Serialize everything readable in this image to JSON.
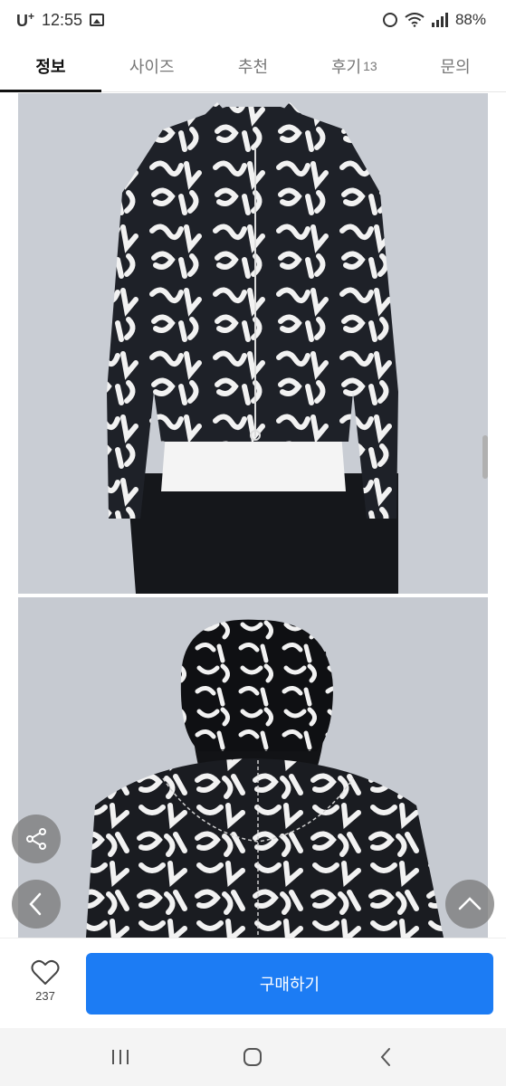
{
  "status_bar": {
    "carrier": "U",
    "carrier_sup": "+",
    "time": "12:55",
    "battery": "88%"
  },
  "tabs": [
    {
      "label": "정보",
      "count": ""
    },
    {
      "label": "사이즈",
      "count": ""
    },
    {
      "label": "추천",
      "count": ""
    },
    {
      "label": "후기",
      "count": "13"
    },
    {
      "label": "문의",
      "count": ""
    }
  ],
  "active_tab": "정보",
  "purchase": {
    "like_count": "237",
    "buy_label": "구매하기"
  },
  "colors": {
    "accent": "#1c7cf4",
    "fab_bg": "#787878"
  },
  "icons": [
    "gallery-icon",
    "alarm-icon",
    "wifi-icon",
    "signal-icon",
    "share-icon",
    "chevron-left-icon",
    "chevron-up-icon",
    "heart-icon",
    "recents-icon",
    "home-icon",
    "back-icon"
  ]
}
